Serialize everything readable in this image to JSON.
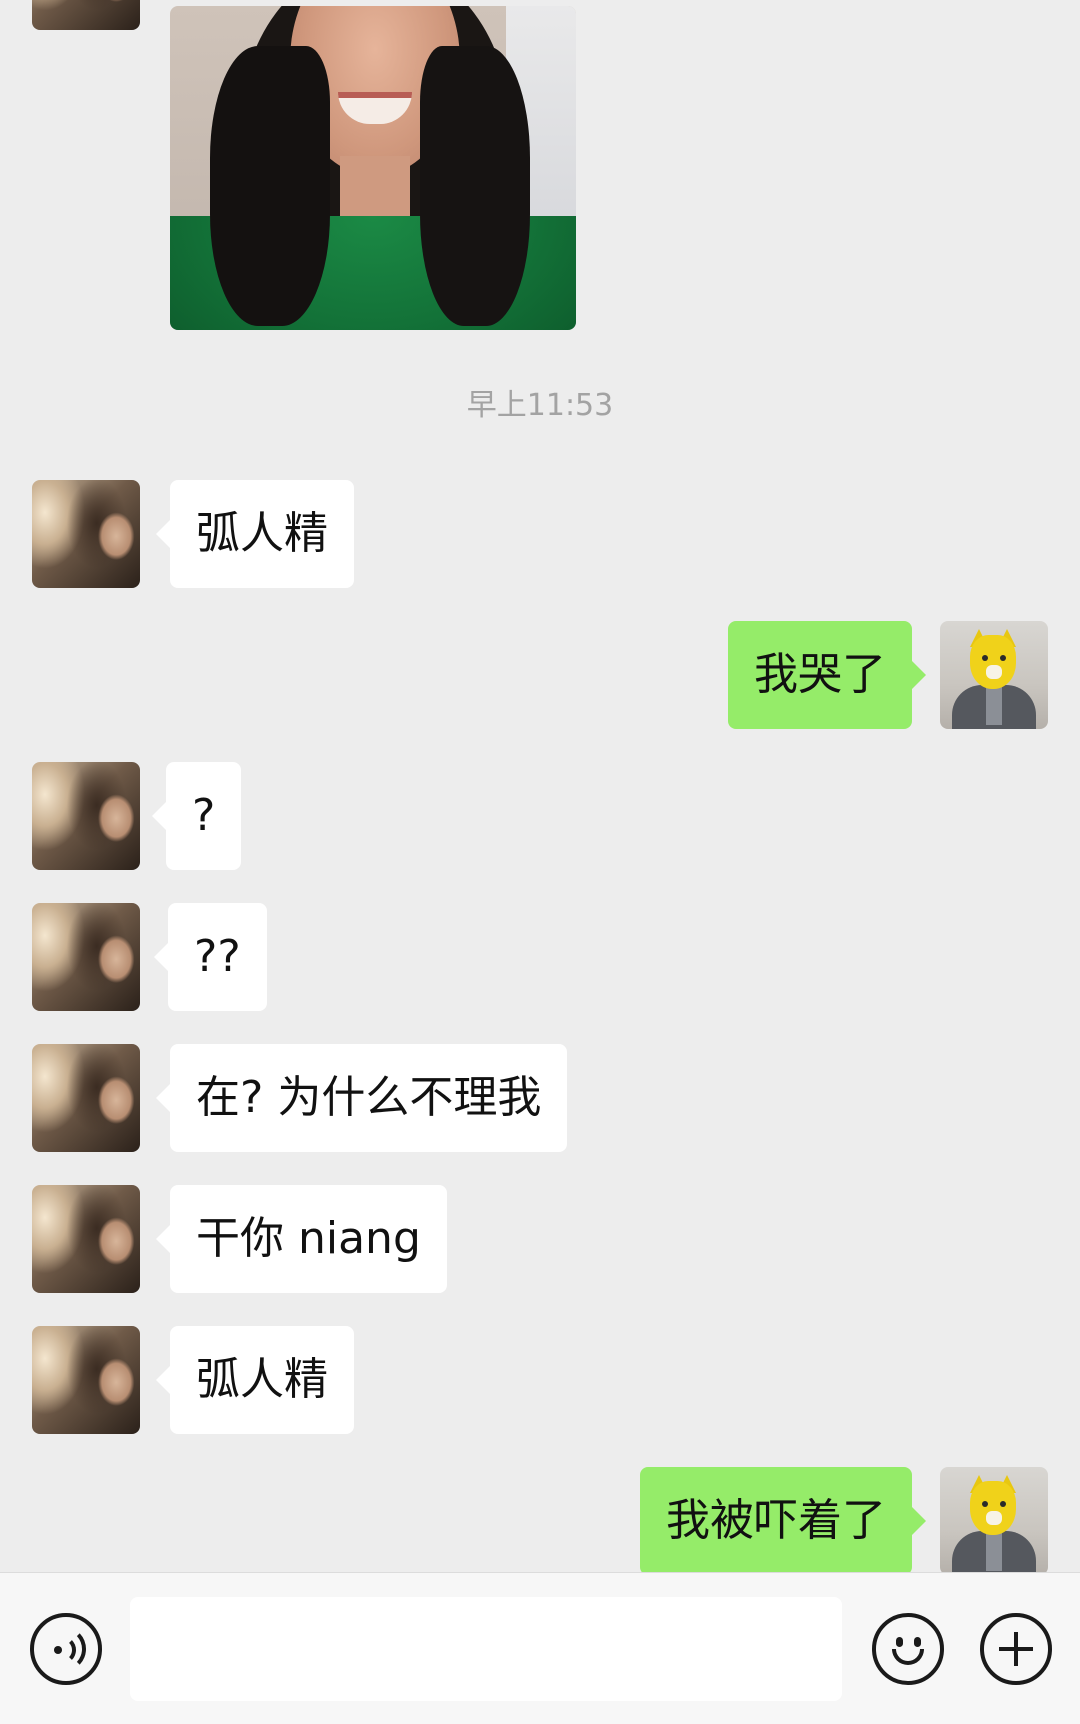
{
  "conversation": {
    "photo_message": {
      "sender": "them",
      "type": "image"
    },
    "timestamp": "早上11:53",
    "messages": [
      {
        "sender": "them",
        "text": "弧人精"
      },
      {
        "sender": "me",
        "text": "我哭了"
      },
      {
        "sender": "them",
        "text": "?"
      },
      {
        "sender": "them",
        "text": "??"
      },
      {
        "sender": "them",
        "text": "在? 为什么不理我"
      },
      {
        "sender": "them",
        "text": "干你 niang"
      },
      {
        "sender": "them",
        "text": "弧人精"
      },
      {
        "sender": "me",
        "text": "我被吓着了"
      }
    ]
  },
  "input_bar": {
    "text_value": "",
    "icons": [
      "voice-icon",
      "emoji-icon",
      "plus-icon"
    ]
  },
  "colors": {
    "background": "#ededed",
    "my_bubble": "#95ec69",
    "their_bubble": "#ffffff",
    "timestamp_text": "#a3a3a3"
  }
}
